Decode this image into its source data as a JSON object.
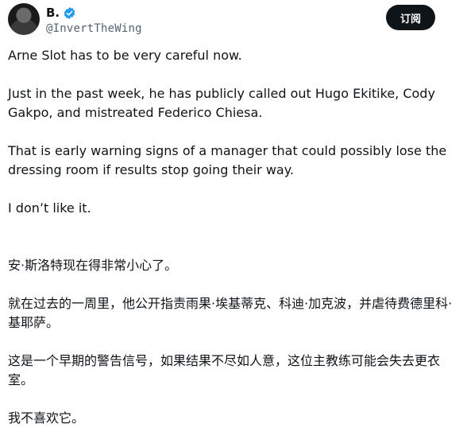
{
  "author": {
    "display_name": "B.",
    "handle": "@InvertTheWing",
    "verified": true,
    "avatar_icon": "user-avatar",
    "verified_icon": "verified-badge-icon"
  },
  "actions": {
    "subscribe_label": "订阅"
  },
  "colors": {
    "verified_blue": "#1d9bf0",
    "button_bg": "#0f1419",
    "handle_gray": "#536471"
  },
  "post": {
    "english": [
      "Arne Slot has to be very careful now.",
      "Just in the past week, he has publicly called out Hugo Ekitike, Cody Gakpo, and mistreated Federico Chiesa.",
      "That is early warning signs of a manager that could possibly lose the dressing room if results stop going their way.",
      "I don’t like it."
    ],
    "translation": [
      "安·斯洛特现在得非常小心了。",
      "就在过去的一周里，他公开指责雨果·埃基蒂克、科迪·加克波，并虐待费德里科·基耶萨。",
      "这是一个早期的警告信号，如果结果不尽如人意，这位主教练可能会失去更衣室。",
      "我不喜欢它。"
    ]
  }
}
